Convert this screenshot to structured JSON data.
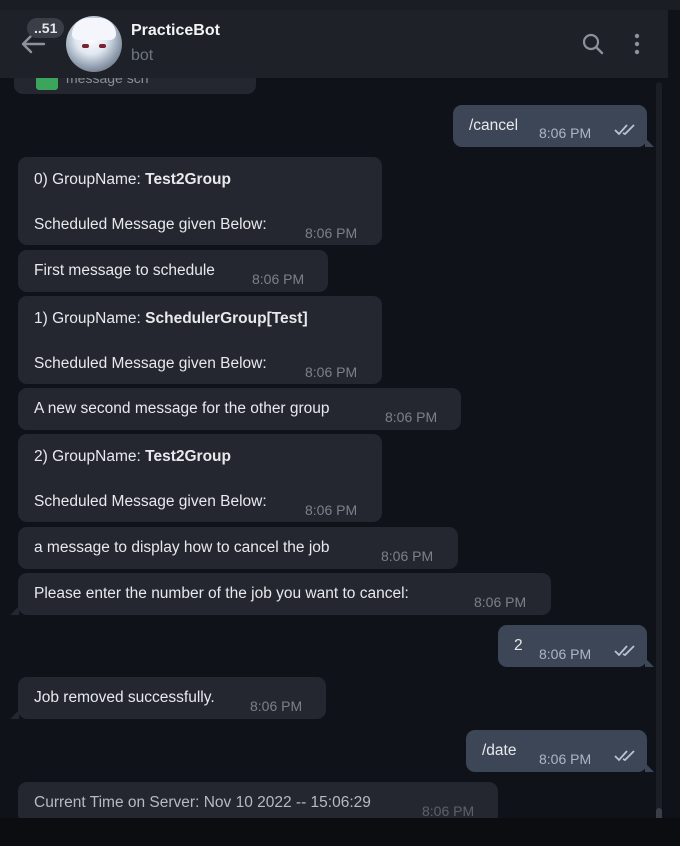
{
  "header": {
    "badge": "..51",
    "title": "PracticeBot",
    "subtitle": "bot"
  },
  "partial_message": {
    "text": "message sch",
    "time": "8:06 PM"
  },
  "messages": [
    {
      "dir": "out",
      "text": "/cancel",
      "time": "8:06 PM"
    },
    {
      "dir": "in",
      "prefix": "0)  GroupName: ",
      "bold": "Test2Group",
      "line2": "Scheduled Message given Below:",
      "time": "8:06 PM"
    },
    {
      "dir": "in",
      "text": "First message to schedule",
      "time": "8:06 PM"
    },
    {
      "dir": "in",
      "prefix": "1)  GroupName: ",
      "bold": "SchedulerGroup[Test]",
      "line2": "Scheduled Message given Below:",
      "time": "8:06 PM"
    },
    {
      "dir": "in",
      "text": "A new second message for the other group",
      "time": "8:06 PM"
    },
    {
      "dir": "in",
      "prefix": "2)  GroupName: ",
      "bold": "Test2Group",
      "line2": "Scheduled Message given Below:",
      "time": "8:06 PM"
    },
    {
      "dir": "in",
      "text": "a message to display how to cancel the job",
      "time": "8:06 PM"
    },
    {
      "dir": "in",
      "text": "Please enter the number of the job you want to cancel:",
      "time": "8:06 PM"
    },
    {
      "dir": "out",
      "text": "2",
      "time": "8:06 PM"
    },
    {
      "dir": "in",
      "text": "Job removed successfully.",
      "time": "8:06 PM"
    },
    {
      "dir": "out",
      "text": "/date",
      "time": "8:06 PM"
    },
    {
      "dir": "in",
      "text": "Current Time on Server: Nov 10 2022 -- 15:06:29",
      "time": "8:06 PM"
    }
  ],
  "colors": {
    "incoming": "#242730",
    "outgoing": "#3d4656",
    "background": "#0f1219",
    "header": "#1e2127"
  },
  "icons": {
    "back": "back-arrow-icon",
    "search": "search-icon",
    "more": "more-vert-icon",
    "read": "double-check-icon"
  }
}
